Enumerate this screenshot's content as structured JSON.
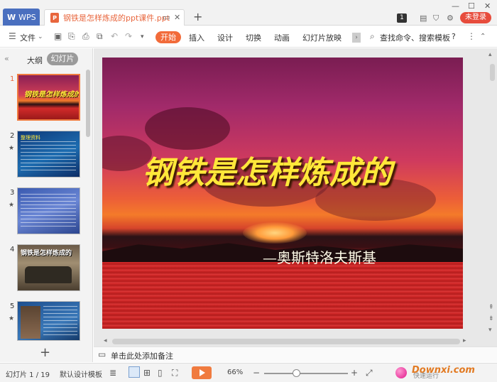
{
  "titlebar": {
    "app_tab": "WPS",
    "doc_title": "钢铁是怎样炼成的ppt课件.ppt",
    "badge": "1",
    "login": "未登录"
  },
  "menubar": {
    "file": "文件",
    "items": [
      "开始",
      "插入",
      "设计",
      "切换",
      "动画",
      "幻灯片放映"
    ],
    "search": "查找命令、搜索模板",
    "help": "?"
  },
  "leftpane": {
    "tab_outline": "大纲",
    "tab_slides": "幻灯片",
    "slides": [
      {
        "num": "1",
        "caption": "钢铁是怎样炼成的"
      },
      {
        "num": "2",
        "caption": "整理资料"
      },
      {
        "num": "3",
        "caption": ""
      },
      {
        "num": "4",
        "caption": "钢铁是怎样炼成的"
      },
      {
        "num": "5",
        "caption": ""
      }
    ]
  },
  "slide": {
    "title": "钢铁是怎样炼成的",
    "author": "—奥斯特洛夫斯基"
  },
  "notes": {
    "placeholder": "单击此处添加备注"
  },
  "statusbar": {
    "slide_count": "幻灯片 1 / 19",
    "template": "默认设计模板",
    "zoom": "66%",
    "zoom_level": 0.38,
    "watermark_text": "Downxi.com",
    "watermark_sub": "快速运行"
  },
  "colors": {
    "accent": "#f26b3a",
    "wps_blue": "#4a6fbf",
    "login_red": "#e74c3c",
    "title_yellow": "#ffe83a"
  }
}
